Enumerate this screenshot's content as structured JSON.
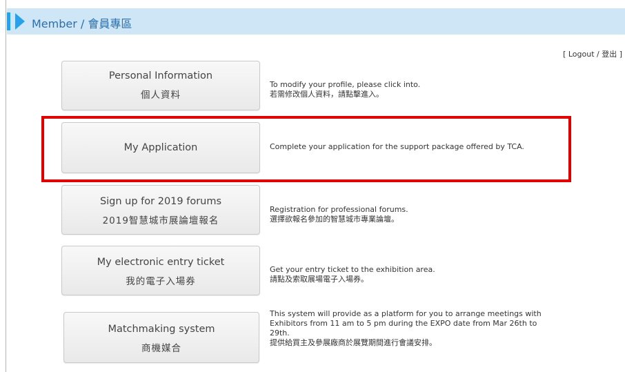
{
  "header": {
    "title": "Member / 會員專區",
    "accent": "#2aa0e8",
    "background": "#cfe6f6"
  },
  "logout_label": "[ Logout / 登出 ]",
  "highlight_color": "#e00000",
  "items": [
    {
      "button_line1": "Personal Information",
      "button_line2": "個人資料",
      "desc_lines": [
        "To modify your profile, please click into.",
        "若需修改個人資料，請點擊進入。"
      ]
    },
    {
      "button_line1": "My Application",
      "button_line2": "",
      "desc_lines": [
        "Complete your application for the support package offered by TCA."
      ]
    },
    {
      "button_line1": "Sign up for 2019 forums",
      "button_line2": "2019智慧城市展論壇報名",
      "desc_lines": [
        "Registration for professional forums.",
        "選擇欲報名參加的智慧城市專業論壇。"
      ]
    },
    {
      "button_line1": "My electronic entry ticket",
      "button_line2": "我的電子入場券",
      "desc_lines": [
        "Get your entry ticket to the exhibition area.",
        "請點及索取展場電子入場券。"
      ]
    },
    {
      "button_line1": "Matchmaking system",
      "button_line2": "商機媒合",
      "desc_lines": [
        "This system will provide as a platform for you to arrange meetings with",
        "Exhibitors from 11 am to 5 pm during the EXPO date from Mar 26th to",
        "29th.",
        "提供給買主及參展廠商於展覽期間進行會議安排。"
      ]
    }
  ]
}
